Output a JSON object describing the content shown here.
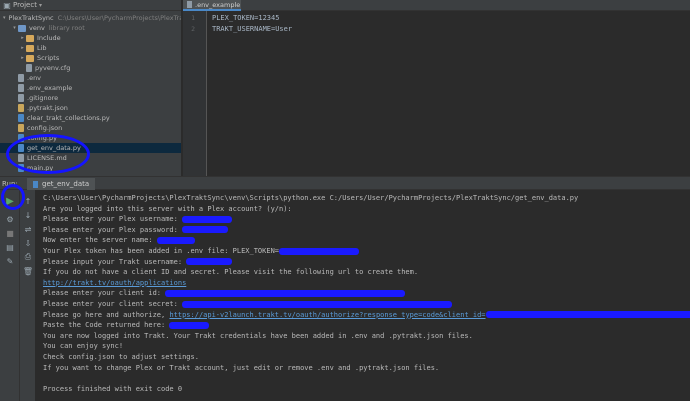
{
  "project_panel": {
    "header_label": "Project",
    "tree": [
      {
        "name": "PlexTraktSync",
        "extra": "C:\\Users\\User\\PycharmProjects\\PlexTra",
        "icon": "folder-icon",
        "depth": 0,
        "expanded": true
      },
      {
        "name": "venv",
        "extra": "library root",
        "icon": "folder-icon",
        "depth": 1,
        "expanded": true
      },
      {
        "name": "Include",
        "extra": "",
        "icon": "folder-icon",
        "depth": 2,
        "expanded": false
      },
      {
        "name": "Lib",
        "extra": "",
        "icon": "folder-icon",
        "depth": 2,
        "expanded": false
      },
      {
        "name": "Scripts",
        "extra": "",
        "icon": "folder-icon",
        "depth": 2,
        "expanded": false
      },
      {
        "name": "pyvenv.cfg",
        "extra": "",
        "icon": "file-icon",
        "depth": 2,
        "expanded": null
      },
      {
        "name": ".env",
        "extra": "",
        "icon": "file-icon",
        "depth": 1,
        "expanded": null
      },
      {
        "name": ".env_example",
        "extra": "",
        "icon": "file-icon",
        "depth": 1,
        "expanded": null
      },
      {
        "name": ".gitignore",
        "extra": "",
        "icon": "file-icon",
        "depth": 1,
        "expanded": null
      },
      {
        "name": ".pytrakt.json",
        "extra": "",
        "icon": "json-icon",
        "depth": 1,
        "expanded": null
      },
      {
        "name": "clear_trakt_collections.py",
        "extra": "",
        "icon": "python-file-icon",
        "depth": 1,
        "expanded": null
      },
      {
        "name": "config.json",
        "extra": "",
        "icon": "json-icon",
        "depth": 1,
        "expanded": null
      },
      {
        "name": "config.py",
        "extra": "",
        "icon": "python-file-icon",
        "depth": 1,
        "expanded": null
      },
      {
        "name": "get_env_data.py",
        "extra": "",
        "icon": "python-file-icon",
        "depth": 1,
        "expanded": null,
        "selected": true
      },
      {
        "name": "LICENSE.md",
        "extra": "",
        "icon": "file-icon",
        "depth": 1,
        "expanded": null
      },
      {
        "name": "main.py",
        "extra": "",
        "icon": "python-file-icon",
        "depth": 1,
        "expanded": null
      }
    ]
  },
  "editor": {
    "tab_label": ".env_example",
    "lines": [
      {
        "num": "1",
        "text": "PLEX_TOKEN=12345"
      },
      {
        "num": "2",
        "text": "TRAKT_USERNAME=User"
      }
    ]
  },
  "run_window": {
    "label": "Run:",
    "tab_label": "get_env_data",
    "console": [
      {
        "text": "C:\\Users\\User\\PycharmProjects\\PlexTraktSync\\venv\\Scripts\\python.exe C:/Users/User/PycharmProjects/PlexTraktSync/get_env_data.py"
      },
      {
        "text": "Are you logged into this server with a Plex account? (y/n): "
      },
      {
        "text": "Please enter your Plex username: "
      },
      {
        "text": "Please enter your Plex password: "
      },
      {
        "text": "Now enter the server name: "
      },
      {
        "text": "Your Plex token has been added in .env file: PLEX_TOKEN="
      },
      {
        "text": "Please input your Trakt username: "
      },
      {
        "text": "If you do not have a client ID and secret. Please visit the following url to create them."
      },
      {
        "link": "http://trakt.tv/oauth/applications"
      },
      {
        "text": "Please enter your client id: "
      },
      {
        "text": "Please enter your client secret: "
      },
      {
        "text": "Please go here and authorize, ",
        "link": "https://api-v2launch.trakt.tv/oauth/authorize?response_type=code&client_id="
      },
      {
        "text": "Paste the Code returned here: "
      },
      {
        "text": "You are now logged into Trakt. Your Trakt credentials have been added in .env and .pytrakt.json files."
      },
      {
        "text": "You can enjoy sync!"
      },
      {
        "text": "Check config.json to adjust settings."
      },
      {
        "text": "If you want to change Plex or Trakt account, just edit or remove .env and .pytrakt.json files."
      },
      {
        "text": ""
      },
      {
        "text": "Process finished with exit code 0"
      }
    ]
  },
  "colors": {
    "annotation": "#1414ff",
    "redaction": "#1a1aff",
    "link": "#5a9bd8",
    "selection": "#0d293e"
  }
}
